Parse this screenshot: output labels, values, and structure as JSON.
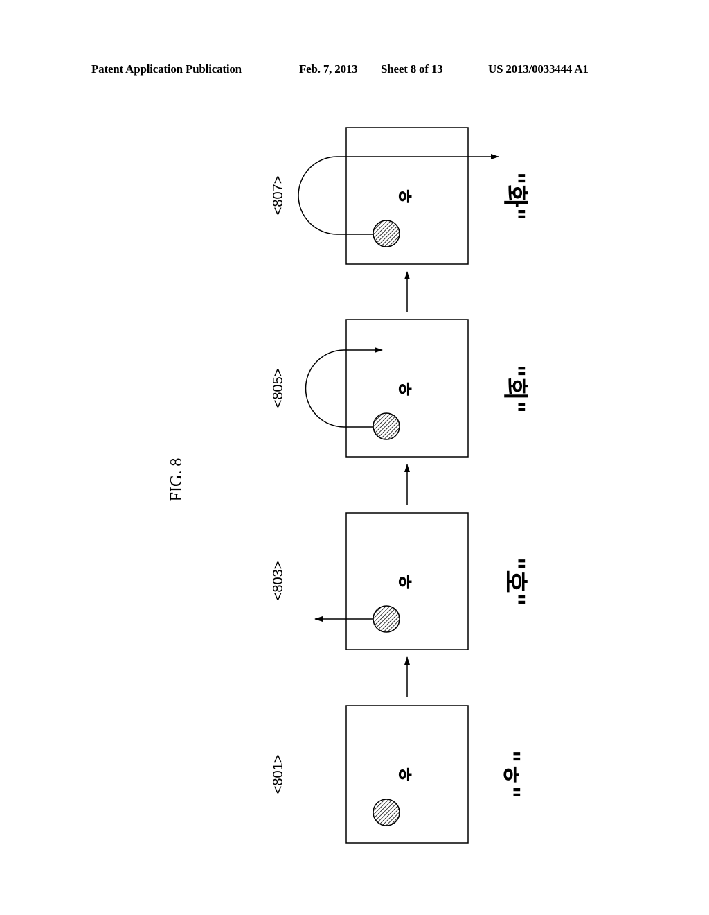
{
  "header": {
    "publication": "Patent Application Publication",
    "date": "Feb. 7, 2013",
    "sheet": "Sheet 8 of 13",
    "number": "US 2013/0033444 A1"
  },
  "figure": {
    "title": "FIG. 8",
    "orientation": "rotated 90° (landscape figure on portrait sheet)",
    "panels": [
      {
        "id": "801",
        "label": "<801>",
        "key_char": "ㅎ",
        "output": "\"ㅎ\"",
        "gesture": "none"
      },
      {
        "id": "803",
        "label": "<803>",
        "key_char": "ㅎ",
        "output": "\"호\"",
        "gesture": "straight drag"
      },
      {
        "id": "805",
        "label": "<805>",
        "key_char": "ㅎ",
        "output": "\"회\"",
        "gesture": "curved drag, return inside key"
      },
      {
        "id": "807",
        "label": "<807>",
        "key_char": "ㅎ",
        "output": "\"화\"",
        "gesture": "curved drag, exit beyond key"
      }
    ]
  }
}
